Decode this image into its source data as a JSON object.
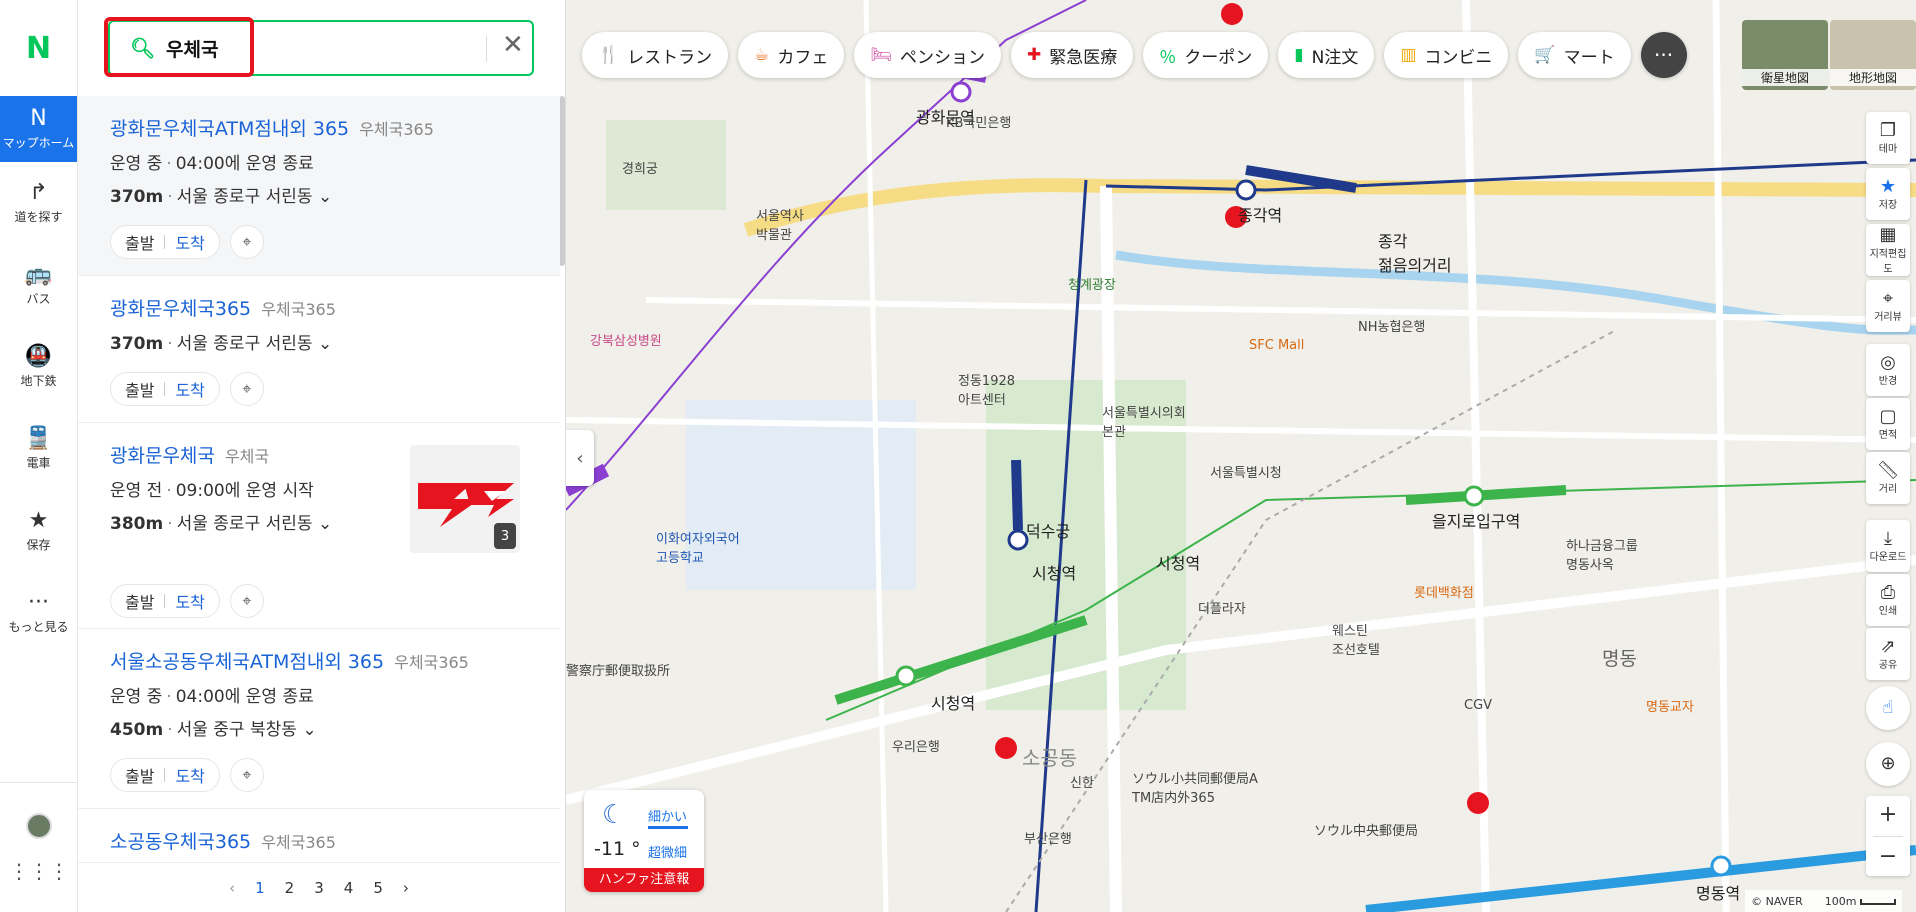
{
  "rail": {
    "logo": "N",
    "items": [
      {
        "label": "マップホーム",
        "icon": "N"
      },
      {
        "label": "道を探す",
        "icon": "↱"
      },
      {
        "label": "バス",
        "icon": "🚌"
      },
      {
        "label": "地下鉄",
        "icon": "🚇"
      },
      {
        "label": "電車",
        "icon": "🚆"
      },
      {
        "label": "保存",
        "icon": "★"
      },
      {
        "label": "もっと見る",
        "icon": "···"
      }
    ]
  },
  "search": {
    "value": "우체국",
    "clear": "✕"
  },
  "results": [
    {
      "title": "광화문우체국ATM점내외 365",
      "category": "우체국365",
      "status": "운영 중",
      "hours": "04:00에 운영 종료",
      "distance": "370m",
      "address": "서울 종로구 서린동",
      "depart": "출발",
      "arrive": "도착"
    },
    {
      "title": "광화문우체국365",
      "category": "우체국365",
      "distance": "370m",
      "address": "서울 종로구 서린동",
      "depart": "출발",
      "arrive": "도착"
    },
    {
      "title": "광화문우체국",
      "category": "우체국",
      "status": "운영 전",
      "hours": "09:00에 운영 시작",
      "distance": "380m",
      "address": "서울 종로구 서린동",
      "depart": "출발",
      "arrive": "도착",
      "photo_count": "3"
    },
    {
      "title": "서울소공동우체국ATM점내외 365",
      "category": "우체국365",
      "status": "운영 중",
      "hours": "04:00에 운영 종료",
      "distance": "450m",
      "address": "서울 중구 북창동",
      "depart": "출발",
      "arrive": "도착"
    },
    {
      "title": "소공동우체국365",
      "category": "우체국365"
    }
  ],
  "pager": {
    "pages": [
      "1",
      "2",
      "3",
      "4",
      "5"
    ],
    "current": "1",
    "prev": "‹",
    "next": "›"
  },
  "chips": [
    {
      "label": "レストラン",
      "icon": "🍴",
      "color": "#e8762d"
    },
    {
      "label": "カフェ",
      "icon": "☕",
      "color": "#e8762d"
    },
    {
      "label": "ペンション",
      "icon": "🛏",
      "color": "#d04aa2"
    },
    {
      "label": "緊急医療",
      "icon": "✚",
      "color": "#e5141e"
    },
    {
      "label": "クーポン",
      "icon": "％",
      "color": "#03c75a"
    },
    {
      "label": "N注文",
      "icon": "▮",
      "color": "#03c75a"
    },
    {
      "label": "コンビニ",
      "icon": "▥",
      "color": "#f2a900"
    },
    {
      "label": "マート",
      "icon": "🛒",
      "color": "#f2a900"
    },
    {
      "label": "···",
      "icon": ""
    }
  ],
  "basemaps": [
    "衛星地図",
    "地形地図"
  ],
  "tools": [
    "테마",
    "저장",
    "지적편집도",
    "거리뷰",
    "반경",
    "면적",
    "거리",
    "다운로드",
    "인쇄",
    "공유"
  ],
  "weather": {
    "temp": "-11 °",
    "dust_fine": "細かい",
    "dust_ultra": "超微細",
    "warning": "ハンファ注意報"
  },
  "map_labels": {
    "gyeonghuigung": "경희궁",
    "seoul_museum": "서울역사\n박물관",
    "gwanghwamun_st": "광화문역",
    "jonggak_st": "종각역",
    "jonggak_4": "종각\n젊음의거리",
    "cheonggye_plaza": "청계광장",
    "deoksugung": "덕수궁",
    "cityhall_st": "시청역",
    "cityhall_st2": "시청역",
    "euljiro_st": "을지로입구역",
    "myeongdong_st": "명동역",
    "sogongdong": "소공동",
    "seoul_cityhall": "서울특별시의회\n본관",
    "seoul_cityhall2": "서울특별시청",
    "kb": "KB국민은행",
    "sfc": "SFC Mall",
    "nh": "NH농협은행",
    "lotte": "롯데백화점",
    "myeongdong": "명동",
    "post_a": "ソウル小共同郵便局A\nTM店内外365",
    "post_central": "ソウル中央郵便局",
    "police_post": "警察庁郵便取扱所",
    "gangbuk": "강북삼성병원",
    "ewha": "이화여자외국어\n고등학교",
    "cheongdong": "정동1928\n아트센터",
    "plaza_hotel": "더플라자",
    "westin": "웨스틴\n조선호텔",
    "myeongdong_univ": "명동교자",
    "woori": "우리은행",
    "hana": "하나금융그룹\n명동사옥",
    "cgv": "CGV",
    "busan_bank": "부산은행",
    "shinhan": "신한"
  },
  "copyright": "© NAVER",
  "scale": "100m"
}
